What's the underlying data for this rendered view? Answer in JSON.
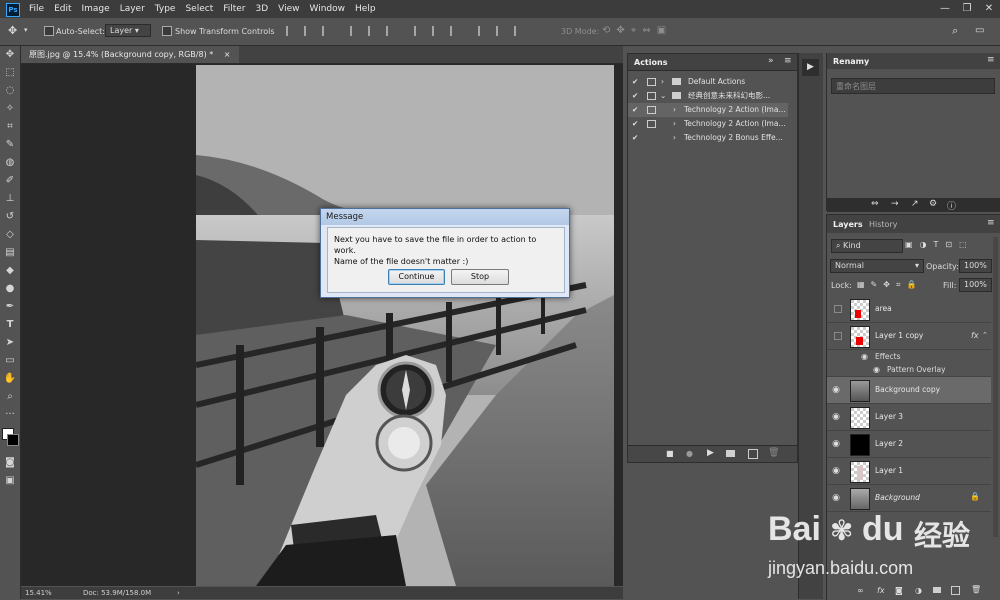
{
  "menu": [
    "File",
    "Edit",
    "Image",
    "Layer",
    "Type",
    "Select",
    "Filter",
    "3D",
    "View",
    "Window",
    "Help"
  ],
  "window_controls": [
    "—",
    "❐",
    "✕"
  ],
  "options_bar": {
    "auto_select_label": "Auto-Select:",
    "auto_select_value": "Layer",
    "transform_label": "Show Transform Controls",
    "mode_3d_label": "3D Mode:"
  },
  "document": {
    "tab_title": "原图.jpg @ 15.4% (Background copy, RGB/8) *",
    "zoom": "15.41%",
    "doc_size": "Doc: 53.9M/158.0M"
  },
  "actions_panel": {
    "title": "Actions",
    "rows": [
      {
        "label": "Default Actions"
      },
      {
        "label": "经典创意未来科幻电影..."
      },
      {
        "label": "Technology 2 Action (Ima..."
      },
      {
        "label": "Technology 2 Action (Ima..."
      },
      {
        "label": "Technology 2 Bonus Effe..."
      }
    ]
  },
  "renamy_panel": {
    "title": "Renamy",
    "search_placeholder": "重命名图层"
  },
  "layers_panel": {
    "tab_layers": "Layers",
    "tab_history": "History",
    "filter_kind": "Kind",
    "blend_mode": "Normal",
    "opacity_label": "Opacity:",
    "opacity_value": "100%",
    "lock_label": "Lock:",
    "fill_label": "Fill:",
    "fill_value": "100%",
    "fx_label": "fx",
    "effects_label": "Effects",
    "pattern_overlay_label": "Pattern Overlay",
    "layers": [
      {
        "name": "area"
      },
      {
        "name": "Layer 1 copy"
      },
      {
        "name": "Background copy"
      },
      {
        "name": "Layer 3"
      },
      {
        "name": "Layer 2"
      },
      {
        "name": "Layer 1"
      },
      {
        "name": "Background"
      }
    ]
  },
  "dialog": {
    "title": "Message",
    "message_line1": "Next you have to save the file in order to action to work.",
    "message_line2": "Name of the file doesn't matter :)",
    "continue_label": "Continue",
    "stop_label": "Stop"
  },
  "watermark": {
    "brand": "Bai",
    "brand2": "du",
    "brand_cn": "经验",
    "url": "jingyan.baidu.com"
  }
}
